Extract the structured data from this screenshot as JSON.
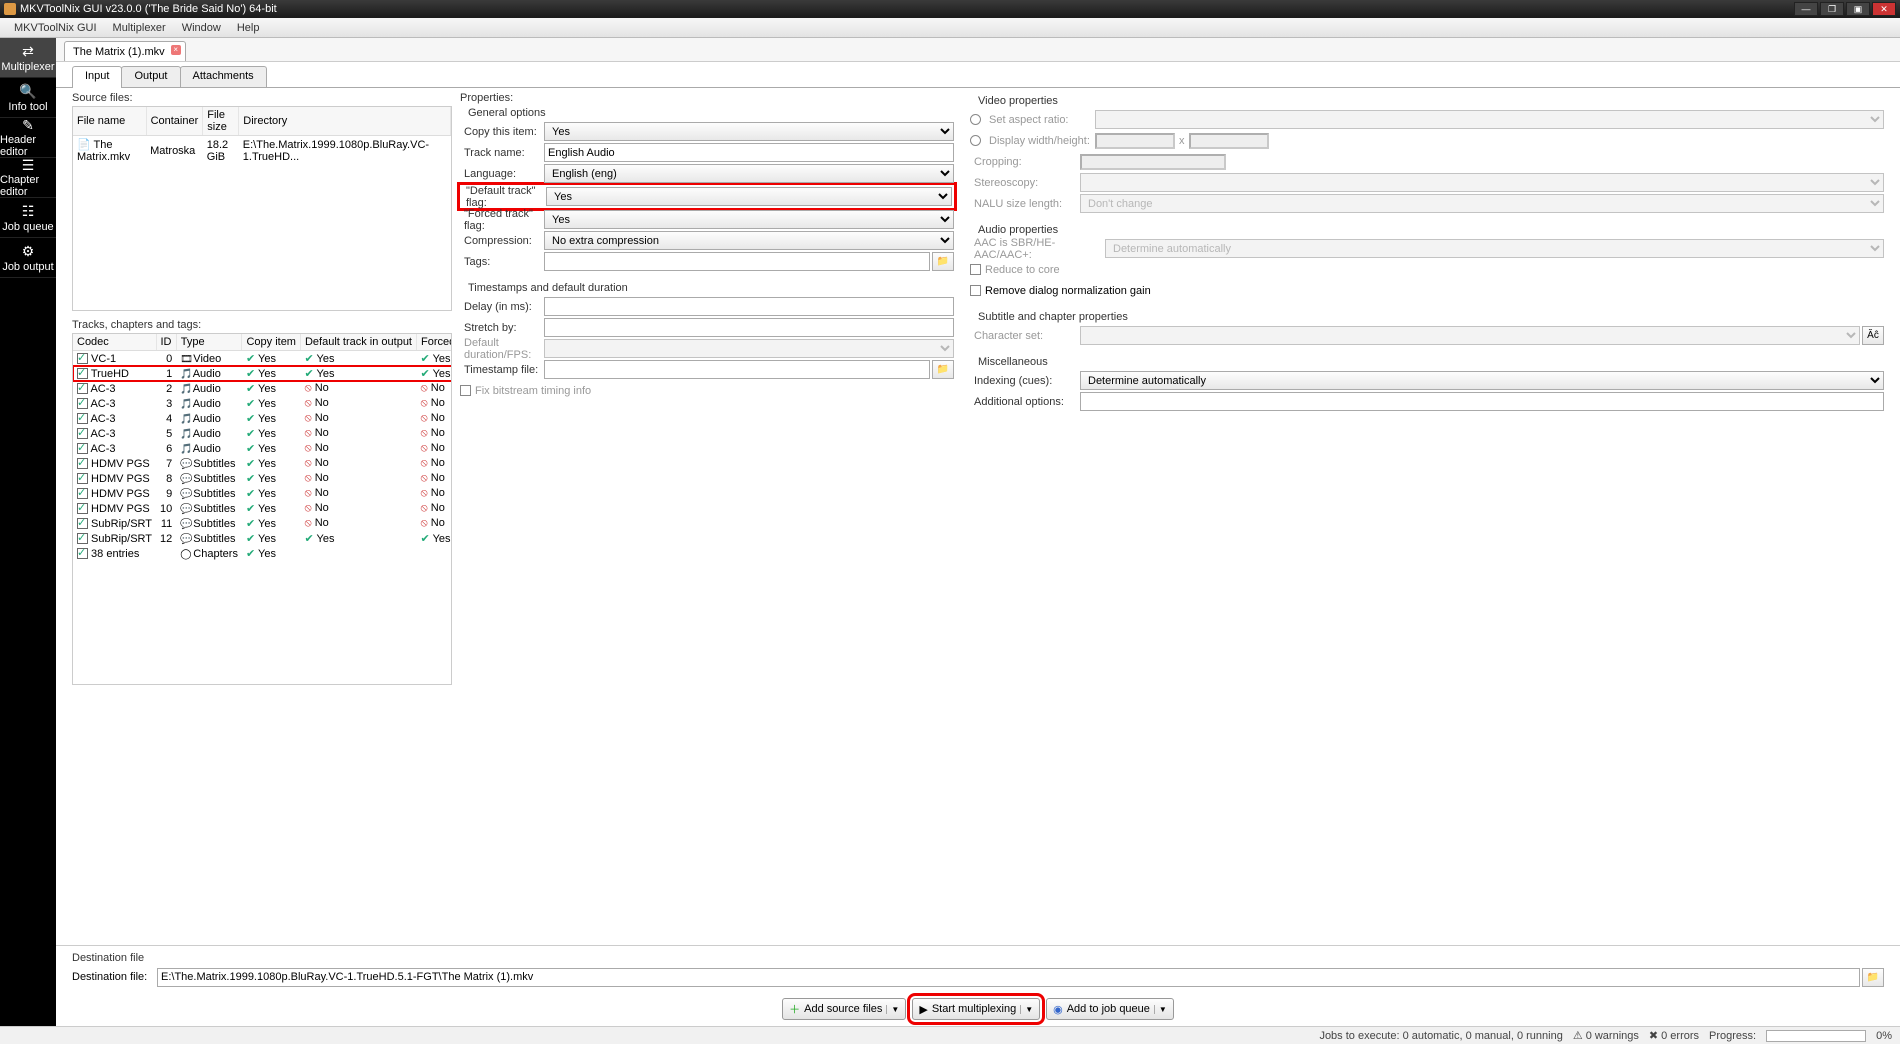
{
  "window": {
    "title": "MKVToolNix GUI v23.0.0 ('The Bride Said No') 64-bit"
  },
  "menubar": [
    "MKVToolNix GUI",
    "Multiplexer",
    "Window",
    "Help"
  ],
  "left_toolbar": [
    {
      "label": "Multiplexer",
      "icon": "⇄"
    },
    {
      "label": "Info tool",
      "icon": "🔍"
    },
    {
      "label": "Header editor",
      "icon": "✎"
    },
    {
      "label": "Chapter editor",
      "icon": "☰"
    },
    {
      "label": "Job queue",
      "icon": "☷"
    },
    {
      "label": "Job output",
      "icon": "⚙"
    }
  ],
  "file_tab": {
    "label": "The Matrix (1).mkv"
  },
  "sub_tabs": [
    "Input",
    "Output",
    "Attachments"
  ],
  "left_col": {
    "source_files_label": "Source files:",
    "src_headers": [
      "File name",
      "Container",
      "File size",
      "Directory"
    ],
    "src_rows": [
      {
        "name": "The Matrix.mkv",
        "container": "Matroska",
        "size": "18.2 GiB",
        "dir": "E:\\The.Matrix.1999.1080p.BluRay.VC-1.TrueHD..."
      }
    ],
    "tracks_label": "Tracks, chapters and tags:",
    "trk_headers": [
      "Codec",
      "ID",
      "Type",
      "Copy item",
      "Default track in output",
      "Forced track"
    ],
    "trk_rows": [
      {
        "codec": "VC-1",
        "id": "0",
        "tico": "🎞",
        "type": "Video",
        "copy": "Yes",
        "def": "Yes",
        "ft": "Yes",
        "hl": false
      },
      {
        "codec": "TrueHD",
        "id": "1",
        "tico": "🎵",
        "type": "Audio",
        "copy": "Yes",
        "def": "Yes",
        "ft": "Yes",
        "hl": true
      },
      {
        "codec": "AC-3",
        "id": "2",
        "tico": "🎵",
        "type": "Audio",
        "copy": "Yes",
        "def": "No",
        "ft": "No",
        "hl": false
      },
      {
        "codec": "AC-3",
        "id": "3",
        "tico": "🎵",
        "type": "Audio",
        "copy": "Yes",
        "def": "No",
        "ft": "No",
        "hl": false
      },
      {
        "codec": "AC-3",
        "id": "4",
        "tico": "🎵",
        "type": "Audio",
        "copy": "Yes",
        "def": "No",
        "ft": "No",
        "hl": false
      },
      {
        "codec": "AC-3",
        "id": "5",
        "tico": "🎵",
        "type": "Audio",
        "copy": "Yes",
        "def": "No",
        "ft": "No",
        "hl": false
      },
      {
        "codec": "AC-3",
        "id": "6",
        "tico": "🎵",
        "type": "Audio",
        "copy": "Yes",
        "def": "No",
        "ft": "No",
        "hl": false
      },
      {
        "codec": "HDMV PGS",
        "id": "7",
        "tico": "💬",
        "type": "Subtitles",
        "copy": "Yes",
        "def": "No",
        "ft": "No",
        "hl": false
      },
      {
        "codec": "HDMV PGS",
        "id": "8",
        "tico": "💬",
        "type": "Subtitles",
        "copy": "Yes",
        "def": "No",
        "ft": "No",
        "hl": false
      },
      {
        "codec": "HDMV PGS",
        "id": "9",
        "tico": "💬",
        "type": "Subtitles",
        "copy": "Yes",
        "def": "No",
        "ft": "No",
        "hl": false
      },
      {
        "codec": "HDMV PGS",
        "id": "10",
        "tico": "💬",
        "type": "Subtitles",
        "copy": "Yes",
        "def": "No",
        "ft": "No",
        "hl": false
      },
      {
        "codec": "SubRip/SRT",
        "id": "11",
        "tico": "💬",
        "type": "Subtitles",
        "copy": "Yes",
        "def": "No",
        "ft": "No",
        "hl": false
      },
      {
        "codec": "SubRip/SRT",
        "id": "12",
        "tico": "💬",
        "type": "Subtitles",
        "copy": "Yes",
        "def": "Yes",
        "ft": "Yes",
        "hl": false
      },
      {
        "codec": "38 entries",
        "id": "",
        "tico": "◯",
        "type": "Chapters",
        "copy": "Yes",
        "def": "",
        "ft": "",
        "hl": false
      }
    ]
  },
  "mid_col": {
    "properties_label": "Properties:",
    "general_label": "General options",
    "copy_label": "Copy this item:",
    "copy_val": "Yes",
    "trackname_label": "Track name:",
    "trackname_val": "English Audio",
    "lang_label": "Language:",
    "lang_val": "English (eng)",
    "deftrack_label": "\"Default track\" flag:",
    "deftrack_val": "Yes",
    "forced_label": "\"Forced track\" flag:",
    "forced_val": "Yes",
    "comp_label": "Compression:",
    "comp_val": "No extra compression",
    "tags_label": "Tags:",
    "ts_label": "Timestamps and default duration",
    "delay_label": "Delay (in ms):",
    "stretch_label": "Stretch by:",
    "fps_label": "Default duration/FPS:",
    "tsfile_label": "Timestamp file:",
    "fix_label": "Fix bitstream timing info"
  },
  "right_col": {
    "video_label": "Video properties",
    "aspect_label": "Set aspect ratio:",
    "disp_label": "Display width/height:",
    "disp_x": "x",
    "crop_label": "Cropping:",
    "stereo_label": "Stereoscopy:",
    "nalu_label": "NALU size length:",
    "nalu_val": "Don't change",
    "audio_label": "Audio properties",
    "aac_label": "AAC is SBR/HE-AAC/AAC+:",
    "aac_val": "Determine automatically",
    "reduce_label": "Reduce to core",
    "remove_label": "Remove dialog normalization gain",
    "sub_label": "Subtitle and chapter properties",
    "charset_label": "Character set:",
    "misc_label": "Miscellaneous",
    "index_label": "Indexing (cues):",
    "index_val": "Determine automatically",
    "addopt_label": "Additional options:"
  },
  "dest": {
    "title": "Destination file",
    "label": "Destination file:",
    "val": "E:\\The.Matrix.1999.1080p.BluRay.VC-1.TrueHD.5.1-FGT\\The Matrix (1).mkv"
  },
  "bottom_btns": {
    "add": "Add source files",
    "start": "Start multiplexing",
    "queue": "Add to job queue"
  },
  "status": {
    "jobs": "Jobs to execute: 0 automatic, 0 manual, 0 running",
    "warn": "0 warnings",
    "err": "0 errors",
    "prog": "Progress:",
    "pct": "0%"
  }
}
